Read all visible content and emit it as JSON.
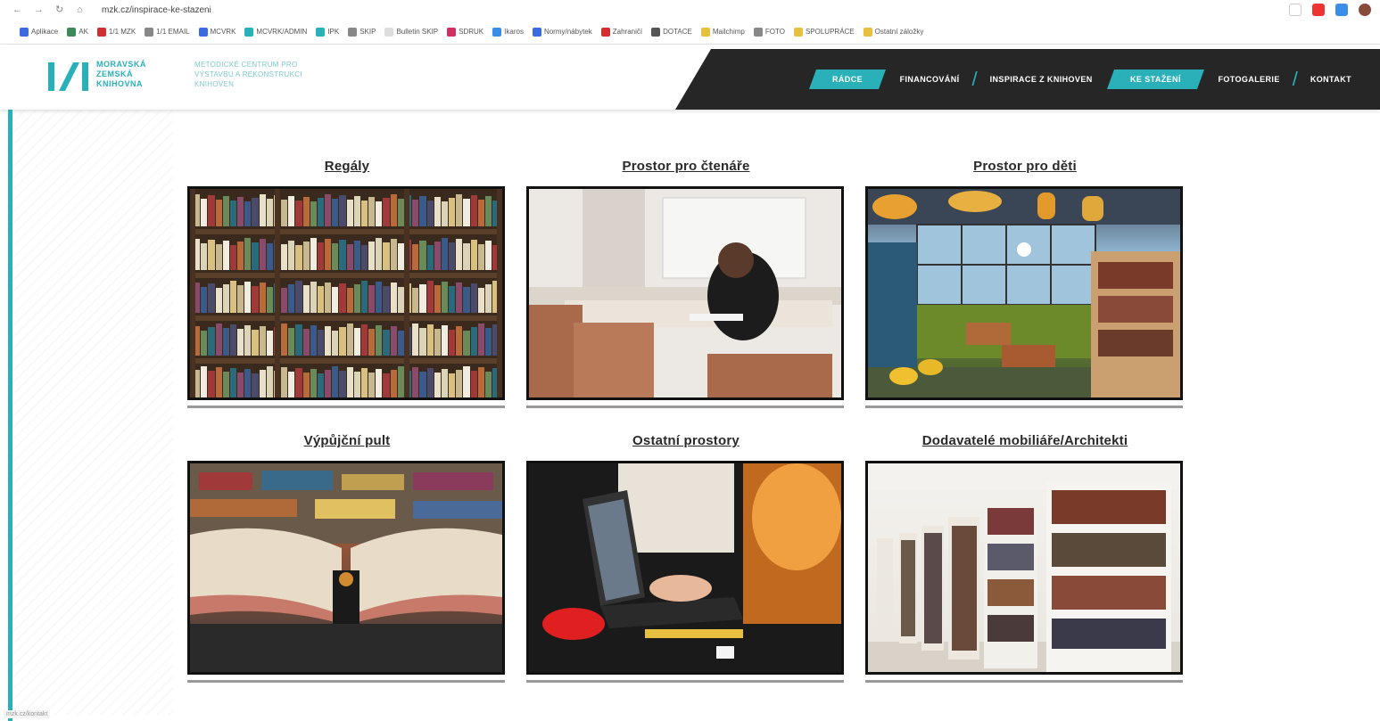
{
  "browser": {
    "url": "mzk.cz/inspirace-ke-stazeni",
    "bookmarks": [
      "Aplikace",
      "AK",
      "1/1 MZK",
      "1/1 EMAIL",
      "MCVRK",
      "MCVRK/ADMIN",
      "IPK",
      "SKIP",
      "Bulletin SKIP",
      "SDRUK",
      "Ikaros",
      "Normy/nábytek",
      "Zahraničí",
      "DOTACE",
      "Mailchimp",
      "FOTO",
      "SPOLUPRÁCE",
      "Ostatní záložky"
    ]
  },
  "logo": {
    "line1": "MORAVSKÁ",
    "line2": "ZEMSKÁ",
    "line3": "KNIHOVNA",
    "sub1": "METODICKÉ CENTRUM PRO",
    "sub2": "VÝSTAVBU A REKONSTRUKCI",
    "sub3": "KNIHOVEN"
  },
  "nav": {
    "items": [
      "RÁDCE",
      "FINANCOVÁNÍ",
      "INSPIRACE Z KNIHOVEN",
      "KE STAŽENÍ",
      "FOTOGALERIE",
      "KONTAKT"
    ]
  },
  "cards": [
    {
      "title": "Regály"
    },
    {
      "title": "Prostor pro čtenáře"
    },
    {
      "title": "Prostor pro děti"
    },
    {
      "title": "Výpůjční pult"
    },
    {
      "title": "Ostatní prostory"
    },
    {
      "title": "Dodavatelé mobiliáře/Architekti"
    }
  ],
  "status": "mzk.cz/kontakt"
}
